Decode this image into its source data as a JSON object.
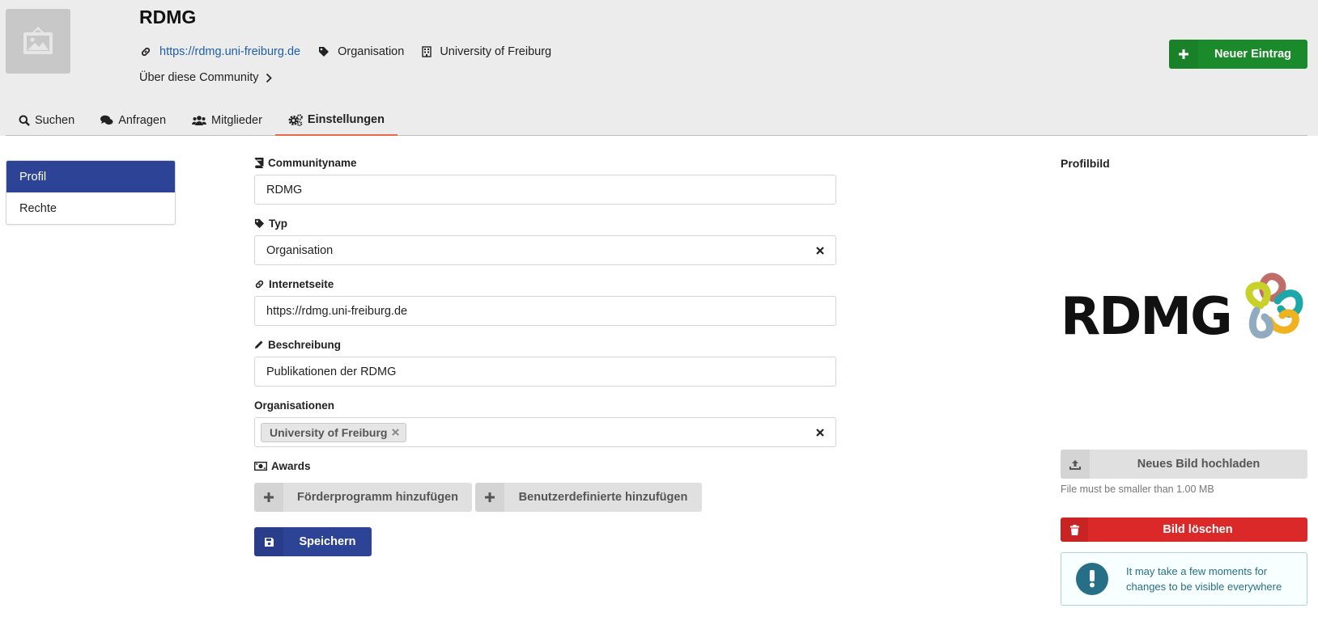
{
  "header": {
    "title": "RDMG",
    "website": "https://rdmg.uni-freiburg.de",
    "type": "Organisation",
    "organisation": "University of Freiburg",
    "about_link": "Über diese Community",
    "new_entry_label": "Neuer Eintrag"
  },
  "tabs": [
    {
      "label": "Suchen",
      "icon": "search-icon"
    },
    {
      "label": "Anfragen",
      "icon": "comments-icon"
    },
    {
      "label": "Mitglieder",
      "icon": "users-icon"
    },
    {
      "label": "Einstellungen",
      "icon": "cogs-icon",
      "active": true
    }
  ],
  "side_menu": {
    "items": [
      {
        "label": "Profil",
        "active": true
      },
      {
        "label": "Rechte",
        "active": false
      }
    ]
  },
  "form": {
    "name_label": "Communityname",
    "name_value": "RDMG",
    "type_label": "Typ",
    "type_value": "Organisation",
    "website_label": "Internetseite",
    "website_value": "https://rdmg.uni-freiburg.de",
    "description_label": "Beschreibung",
    "description_value": "Publikationen der RDMG",
    "organisations_label": "Organisationen",
    "organisations_chip": "University of Freiburg",
    "awards_label": "Awards",
    "add_funding_label": "Förderprogramm hinzufügen",
    "add_custom_label": "Benutzerdefinierte hinzufügen",
    "save_label": "Speichern"
  },
  "profile_image": {
    "title": "Profilbild",
    "logo_text": "RDMG",
    "upload_label": "Neues Bild hochladen",
    "hint": "File must be smaller than 1.00 MB",
    "delete_label": "Bild löschen",
    "notice": "It may take a few moments for changes to be visible everywhere"
  },
  "colors": {
    "primary": "#2d4396",
    "success": "#1b8a2a",
    "danger": "#db2828",
    "link": "#1f5fa8",
    "tab_active_underline": "#e8694a",
    "info": "#276f86"
  }
}
